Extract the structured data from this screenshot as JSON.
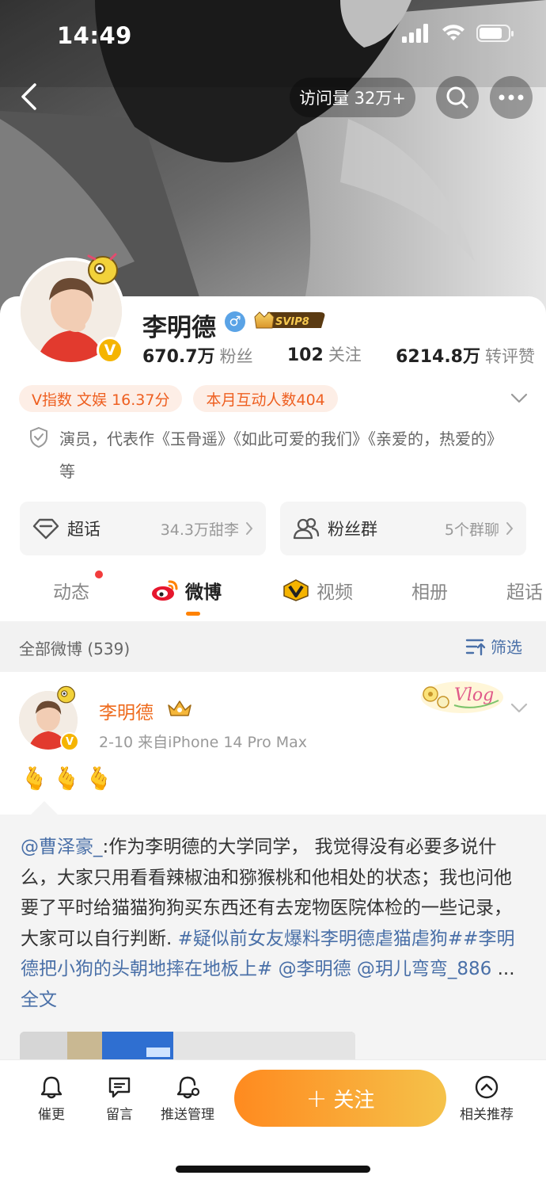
{
  "status_bar": {
    "time": "14:49"
  },
  "header": {
    "visits": "访问量 32万+"
  },
  "profile": {
    "name": "李明德",
    "gender_symbol": "♂",
    "svip_label": "SVIP8",
    "verified_mark": "V",
    "stats": [
      {
        "value": "670.7万",
        "label": "粉丝"
      },
      {
        "value": "102",
        "label": "关注"
      },
      {
        "value": "6214.8万",
        "label": "转评赞"
      }
    ],
    "tags": [
      "V指数 文娱 16.37分",
      "本月互动人数404"
    ],
    "bio": "演员，代表作《玉骨遥》《如此可爱的我们》《亲爱的，热爱的》等",
    "entries": [
      {
        "label": "超话",
        "value": "34.3万甜李",
        "icon": "diamond-icon"
      },
      {
        "label": "粉丝群",
        "value": "5个群聊",
        "icon": "group-icon"
      }
    ]
  },
  "tabs": [
    {
      "label": "动态",
      "active": false,
      "has_dot": true
    },
    {
      "label": "微博",
      "active": true,
      "icon": "weibo-icon"
    },
    {
      "label": "视频",
      "active": false,
      "icon": "video-icon"
    },
    {
      "label": "相册",
      "active": false
    },
    {
      "label": "超话",
      "active": false
    }
  ],
  "filter": {
    "title": "全部微博 (539)",
    "button": "筛选"
  },
  "post": {
    "author": "李明德",
    "meta": "2-10  来自iPhone 14 Pro Max",
    "emoji": "🫰🫰🫰",
    "sticker_text": "Vlog",
    "repost": {
      "mention": "@曹泽豪_",
      "text1": ":作为李明德的大学同学， 我觉得没有必要多说什么，大家只用看看辣椒油和猕猴桃和他相处的状态；我也问他要了平时给猫猫狗狗买东西还有去宠物医院体检的一些记录，大家可以自行判断. ",
      "hashtag1": "#疑似前女友爆料李明德虐猫虐狗#",
      "hashtag2": "#李明德把小狗的头朝地摔在地板上#",
      "space": " ",
      "mention2": "@李明德",
      "mention3": "@玥儿弯弯_886",
      "ellipsis": " ... ",
      "full_text": "全文"
    }
  },
  "bottom_bar": {
    "items": [
      {
        "label": "催更",
        "icon": "bell-icon"
      },
      {
        "label": "留言",
        "icon": "comment-icon"
      },
      {
        "label": "推送管理",
        "icon": "bell-settings-icon"
      },
      {
        "label": "相关推荐",
        "icon": "chevron-up-circle-icon"
      }
    ],
    "follow_plus": "+",
    "follow_label": "关注"
  },
  "colors": {
    "accent": "#ff8200",
    "link": "#4a70a8",
    "tag_text": "#ee5f20",
    "name_orange": "#ee6a1c"
  }
}
